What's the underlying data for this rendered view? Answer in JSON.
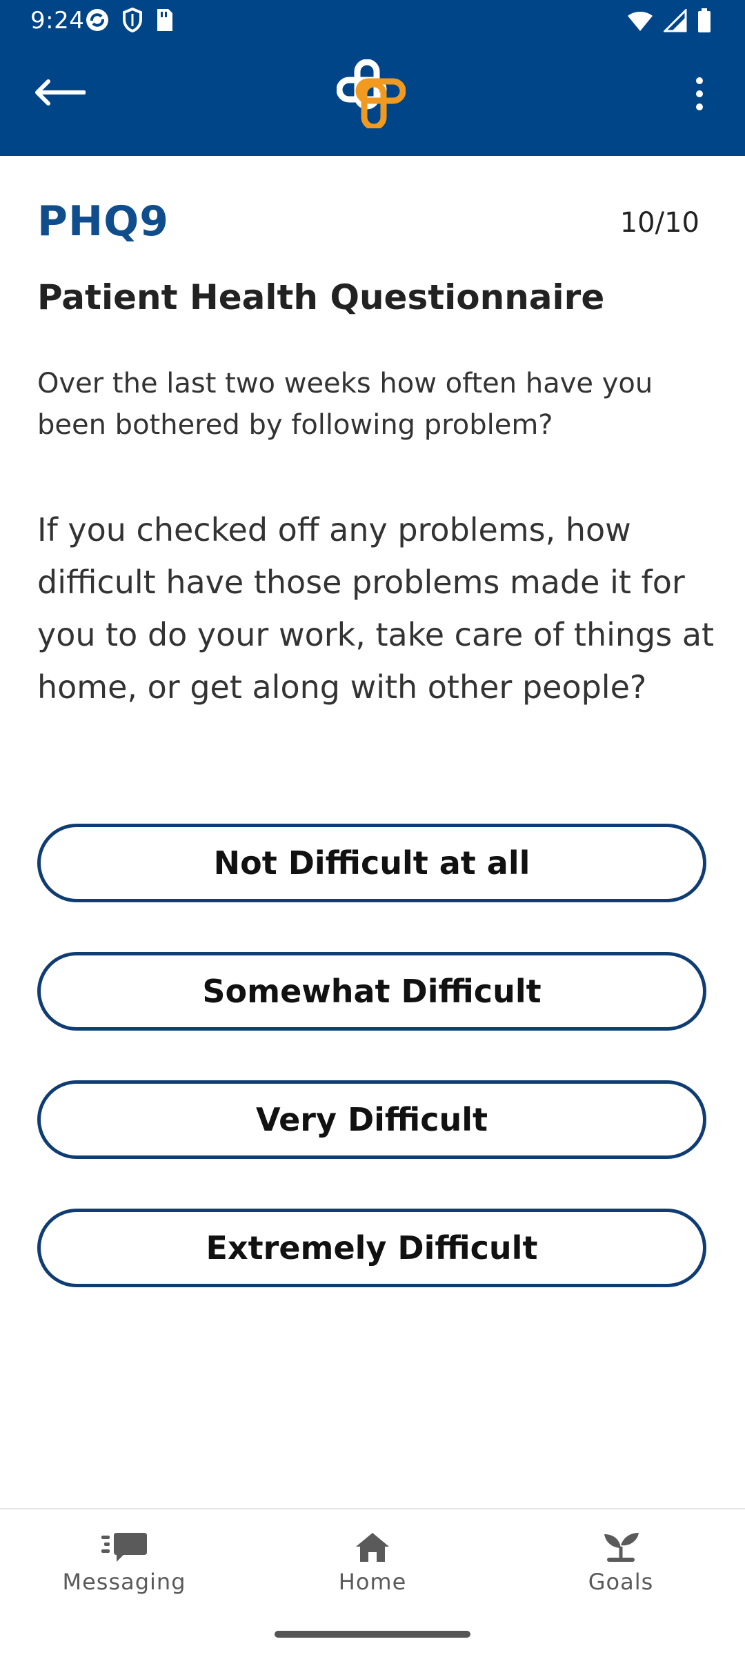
{
  "status_bar": {
    "time": "9:24",
    "left_icons": [
      "sync-icon",
      "shield-icon",
      "sim-card-icon"
    ],
    "right_icons": [
      "wifi-icon",
      "signal-icon",
      "battery-icon"
    ]
  },
  "app_bar": {
    "back_icon": "arrow-left-icon",
    "logo": "cross-logo",
    "more_icon": "more-vertical-icon",
    "colors": {
      "background": "#004587",
      "logo_white": "#ffffff",
      "logo_orange": "#f29a1f"
    }
  },
  "questionnaire": {
    "title": "PHQ9",
    "progress": "10/10",
    "subtitle": "Patient Health Questionnaire",
    "intro": "Over the last two weeks how often have you been bothered by following problem?",
    "question": "If you checked off any problems, how difficult have those problems made it for you to do your work, take care of things at home, or get along with other people?",
    "options": [
      "Not Difficult at all",
      "Somewhat Difficult",
      "Very Difficult",
      "Extremely Difficult"
    ]
  },
  "bottom_nav": {
    "items": [
      {
        "label": "Messaging",
        "icon": "messaging-icon"
      },
      {
        "label": "Home",
        "icon": "home-icon"
      },
      {
        "label": "Goals",
        "icon": "goals-sprout-icon"
      }
    ]
  },
  "colors": {
    "primary": "#0f4d8c",
    "option_border": "#0f3d73"
  }
}
